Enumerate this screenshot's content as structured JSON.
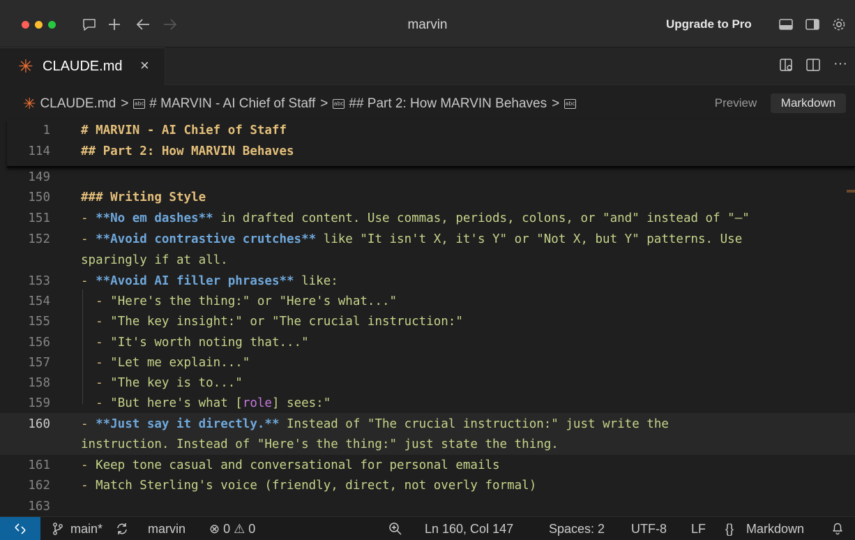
{
  "window": {
    "title": "marvin",
    "upgrade_label": "Upgrade to Pro"
  },
  "tab": {
    "name": "CLAUDE.md",
    "close_glyph": "×"
  },
  "breadcrumb": {
    "file": "CLAUDE.md",
    "items": [
      "# MARVIN - AI Chief of Staff",
      "## Part 2: How MARVIN Behaves"
    ],
    "abc_glyph": "abc",
    "separator": ">"
  },
  "view_toggle": {
    "preview": "Preview",
    "markdown": "Markdown"
  },
  "editor": {
    "sticky": [
      {
        "ln": "1",
        "text": "# MARVIN - AI Chief of Staff"
      },
      {
        "ln": "114",
        "text": "## Part 2: How MARVIN Behaves"
      }
    ],
    "lines": [
      {
        "ln": "149"
      },
      {
        "ln": "150",
        "heading": "### Writing Style"
      },
      {
        "ln": "151",
        "dash": "- ",
        "bold": "**No em dashes**",
        "rest": " in drafted content. Use commas, periods, colons, or \"and\" instead of \"—\""
      },
      {
        "ln": "152",
        "dash": "- ",
        "bold": "**Avoid contrastive crutches**",
        "rest": " like \"It isn't X, it's Y\" or \"Not X, but Y\" patterns. Use",
        "wrap": "sparingly if at all."
      },
      {
        "ln": "153",
        "dash": "- ",
        "bold": "**Avoid AI filler phrases**",
        "rest": " like:"
      },
      {
        "ln": "154",
        "dash": "  - ",
        "rest": "\"Here's the thing:\" or \"Here's what...\""
      },
      {
        "ln": "155",
        "dash": "  - ",
        "rest": "\"The key insight:\" or \"The crucial instruction:\""
      },
      {
        "ln": "156",
        "dash": "  - ",
        "rest": "\"It's worth noting that...\""
      },
      {
        "ln": "157",
        "dash": "  - ",
        "rest": "\"Let me explain...\""
      },
      {
        "ln": "158",
        "dash": "  - ",
        "rest": "\"The key is to...\""
      },
      {
        "ln": "159",
        "dash": "  - ",
        "rest_before": "\"But here's what [",
        "role": "role",
        "rest_after": "] sees:\""
      },
      {
        "ln": "160",
        "dash": "- ",
        "bold": "**Just say it directly.**",
        "rest": " Instead of \"The crucial instruction:\" just write the",
        "wrap": "instruction. Instead of \"Here's the thing:\" just state the thing."
      },
      {
        "ln": "161",
        "dash": "- ",
        "rest": "Keep tone casual and conversational for personal emails"
      },
      {
        "ln": "162",
        "dash": "- ",
        "rest": "Match Sterling's voice (friendly, direct, not overly formal)"
      },
      {
        "ln": "163"
      }
    ]
  },
  "statusbar": {
    "branch": "main*",
    "project": "marvin",
    "errors": "0",
    "warnings": "0",
    "position": "Ln 160, Col 147",
    "spaces": "Spaces: 2",
    "encoding": "UTF-8",
    "eol": "LF",
    "language": "Markdown"
  },
  "colors": {
    "accent": "#f07132",
    "remote": "#0e639c",
    "heading": "#e5c07b",
    "bold": "#6fa8dc",
    "text": "#c5d58a",
    "role": "#c678dd"
  },
  "icons": [
    "close-traffic-icon",
    "minimize-traffic-icon",
    "zoom-traffic-icon",
    "chat-icon",
    "plus-icon",
    "back-arrow-icon",
    "forward-arrow-icon",
    "panel-bottom-icon",
    "panel-right-icon",
    "gear-icon",
    "preview-side-icon",
    "split-editor-icon",
    "more-icon",
    "markdown-file-icon",
    "remote-icon",
    "branch-icon",
    "sync-icon",
    "error-icon",
    "warning-icon",
    "zoom-icon",
    "bell-icon"
  ]
}
